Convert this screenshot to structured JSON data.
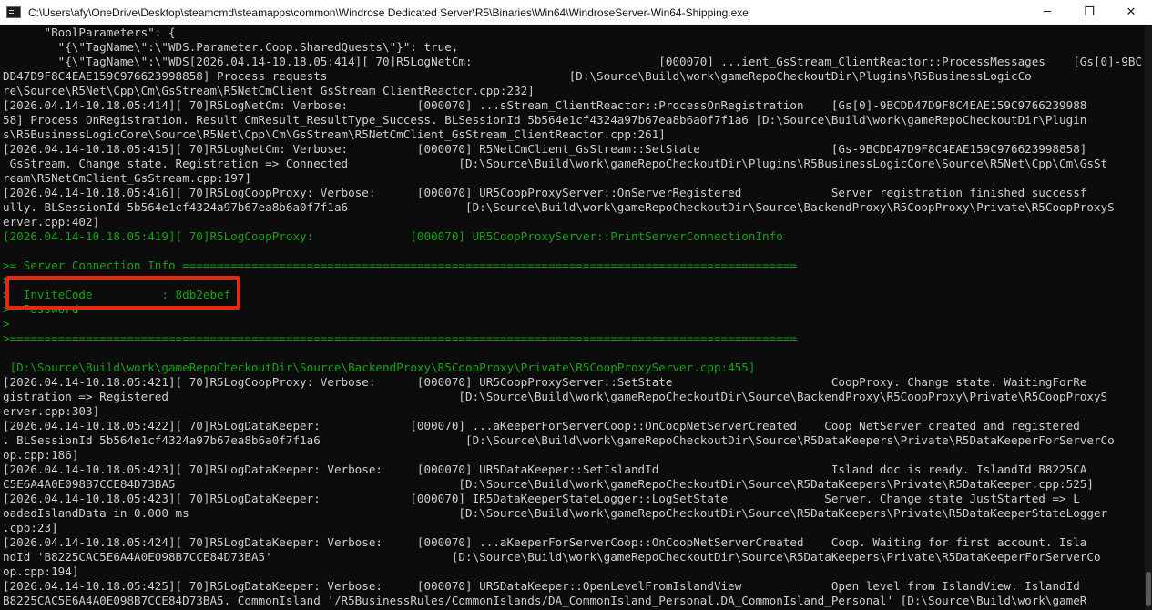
{
  "window": {
    "title": "C:\\Users\\afy\\OneDrive\\Desktop\\steamcmd\\steamapps\\common\\Windrose Dedicated Server\\R5\\Binaries\\Win64\\WindroseServer-Win64-Shipping.exe",
    "minimize_glyph": "─",
    "maximize_glyph": "❐",
    "close_glyph": "✕"
  },
  "console": {
    "lines": [
      {
        "text": "      \"BoolParameters\": {",
        "color": "plain"
      },
      {
        "text": "        \"{\\\"TagName\\\":\\\"WDS.Parameter.Coop.SharedQuests\\\"}\": true,",
        "color": "plain"
      },
      {
        "text": "        \"{\\\"TagName\\\":\\\"WDS[2026.04.14-10.18.05:414][ 70]R5LogNetCm:                           [000070] ...ient_GsStream_ClientReactor::ProcessMessages    [Gs[0]-9BC",
        "color": "plain"
      },
      {
        "text": "DD47D9F8C4EAE159C976623998858] Process requests                                   [D:\\Source\\Build\\work\\gameRepoCheckoutDir\\Plugins\\R5BusinessLogicCo",
        "color": "plain"
      },
      {
        "text": "re\\Source\\R5Net\\Cpp\\Cm\\GsStream\\R5NetCmClient_GsStream_ClientReactor.cpp:232]",
        "color": "plain"
      },
      {
        "text": "[2026.04.14-10.18.05:414][ 70]R5LogNetCm: Verbose:          [000070] ...sStream_ClientReactor::ProcessOnRegistration    [Gs[0]-9BCDD47D9F8C4EAE159C9766239988",
        "color": "plain"
      },
      {
        "text": "58] Process OnRegistration. Result CmResult_ResultType_Success. BLSessionId 5b564e1cf4324a97b67ea8b6a0f7f1a6 [D:\\Source\\Build\\work\\gameRepoCheckoutDir\\Plugin",
        "color": "plain"
      },
      {
        "text": "s\\R5BusinessLogicCore\\Source\\R5Net\\Cpp\\Cm\\GsStream\\R5NetCmClient_GsStream_ClientReactor.cpp:261]",
        "color": "plain"
      },
      {
        "text": "[2026.04.14-10.18.05:415][ 70]R5LogNetCm: Verbose:          [000070] R5NetCmClient_GsStream::SetState                   [Gs-9BCDD47D9F8C4EAE159C976623998858]",
        "color": "plain"
      },
      {
        "text": " GsStream. Change state. Registration => Connected                [D:\\Source\\Build\\work\\gameRepoCheckoutDir\\Plugins\\R5BusinessLogicCore\\Source\\R5Net\\Cpp\\Cm\\GsSt",
        "color": "plain"
      },
      {
        "text": "ream\\R5NetCmClient_GsStream.cpp:197]",
        "color": "plain"
      },
      {
        "text": "[2026.04.14-10.18.05:416][ 70]R5LogCoopProxy: Verbose:      [000070] UR5CoopProxyServer::OnServerRegistered             Server registration finished successf",
        "color": "plain"
      },
      {
        "text": "ully. BLSessionId 5b564e1cf4324a97b67ea8b6a0f7f1a6                 [D:\\Source\\Build\\work\\gameRepoCheckoutDir\\Source\\BackendProxy\\R5CoopProxy\\Private\\R5CoopProxyS",
        "color": "plain"
      },
      {
        "text": "erver.cpp:402]",
        "color": "plain"
      },
      {
        "text": "[2026.04.14-10.18.05:419][ 70]R5LogCoopProxy:              [000070] UR5CoopProxyServer::PrintServerConnectionInfo",
        "color": "green"
      },
      {
        "text": "",
        "color": "green"
      },
      {
        "text": ">= Server Connection Info =========================================================================================",
        "color": "green"
      },
      {
        "text": ">",
        "color": "green"
      },
      {
        "text": ">  InviteCode          : 8db2ebef",
        "color": "green"
      },
      {
        "text": ">  Password",
        "color": "green"
      },
      {
        "text": ">",
        "color": "green"
      },
      {
        "text": ">==================================================================================================================",
        "color": "green"
      },
      {
        "text": "",
        "color": "green"
      },
      {
        "text": " [D:\\Source\\Build\\work\\gameRepoCheckoutDir\\Source\\BackendProxy\\R5CoopProxy\\Private\\R5CoopProxyServer.cpp:455]",
        "color": "green"
      },
      {
        "text": "[2026.04.14-10.18.05:421][ 70]R5LogCoopProxy: Verbose:      [000070] UR5CoopProxyServer::SetState                       CoopProxy. Change state. WaitingForRe",
        "color": "plain"
      },
      {
        "text": "gistration => Registered                                          [D:\\Source\\Build\\work\\gameRepoCheckoutDir\\Source\\BackendProxy\\R5CoopProxy\\Private\\R5CoopProxyS",
        "color": "plain"
      },
      {
        "text": "erver.cpp:303]",
        "color": "plain"
      },
      {
        "text": "[2026.04.14-10.18.05:422][ 70]R5LogDataKeeper:             [000070] ...aKeeperForServerCoop::OnCoopNetServerCreated    Coop NetServer created and registered",
        "color": "plain"
      },
      {
        "text": ". BLSessionId 5b564e1cf4324a97b67ea8b6a0f7f1a6                     [D:\\Source\\Build\\work\\gameRepoCheckoutDir\\Source\\R5DataKeepers\\Private\\R5DataKeeperForServerCo",
        "color": "plain"
      },
      {
        "text": "op.cpp:186]",
        "color": "plain"
      },
      {
        "text": "[2026.04.14-10.18.05:423][ 70]R5LogDataKeeper: Verbose:     [000070] UR5DataKeeper::SetIslandId                         Island doc is ready. IslandId B8225CA",
        "color": "plain"
      },
      {
        "text": "C5E6A4A0E098B7CCE84D73BA5                                         [D:\\Source\\Build\\work\\gameRepoCheckoutDir\\Source\\R5DataKeepers\\Private\\R5DataKeeper.cpp:525]",
        "color": "plain"
      },
      {
        "text": "[2026.04.14-10.18.05:423][ 70]R5LogDataKeeper:             [000070] IR5DataKeeperStateLogger::LogSetState              Server. Change state JustStarted => L",
        "color": "plain"
      },
      {
        "text": "oadedIslandData in 0.000 ms                                       [D:\\Source\\Build\\work\\gameRepoCheckoutDir\\Source\\R5DataKeepers\\Private\\R5DataKeeperStateLogger",
        "color": "plain"
      },
      {
        "text": ".cpp:23]",
        "color": "plain"
      },
      {
        "text": "[2026.04.14-10.18.05:424][ 70]R5LogDataKeeper: Verbose:     [000070] ...aKeeperForServerCoop::OnCoopNetServerCreated    Coop. Waiting for first account. Isla",
        "color": "plain"
      },
      {
        "text": "ndId 'B8225CAC5E6A4A0E098B7CCE84D73BA5'                          [D:\\Source\\Build\\work\\gameRepoCheckoutDir\\Source\\R5DataKeepers\\Private\\R5DataKeeperForServerCo",
        "color": "plain"
      },
      {
        "text": "op.cpp:194]",
        "color": "plain"
      },
      {
        "text": "[2026.04.14-10.18.05:425][ 70]R5LogDataKeeper: Verbose:     [000070] UR5DataKeeper::OpenLevelFromIslandView             Open level from IslandView. IslandId",
        "color": "plain"
      },
      {
        "text": "B8225CAC5E6A4A0E098B7CCE84D73BA5. CommonIsland '/R5BusinessRules/CommonIslands/DA_CommonIsland_Personal.DA_CommonIsland_Personal' [D:\\Source\\Build\\work\\gameR",
        "color": "plain"
      }
    ]
  },
  "colors": {
    "console_bg": "#0c0c0c",
    "console_text": "#cccccc",
    "console_green": "#13a10e",
    "highlight_box": "#e8280c"
  }
}
